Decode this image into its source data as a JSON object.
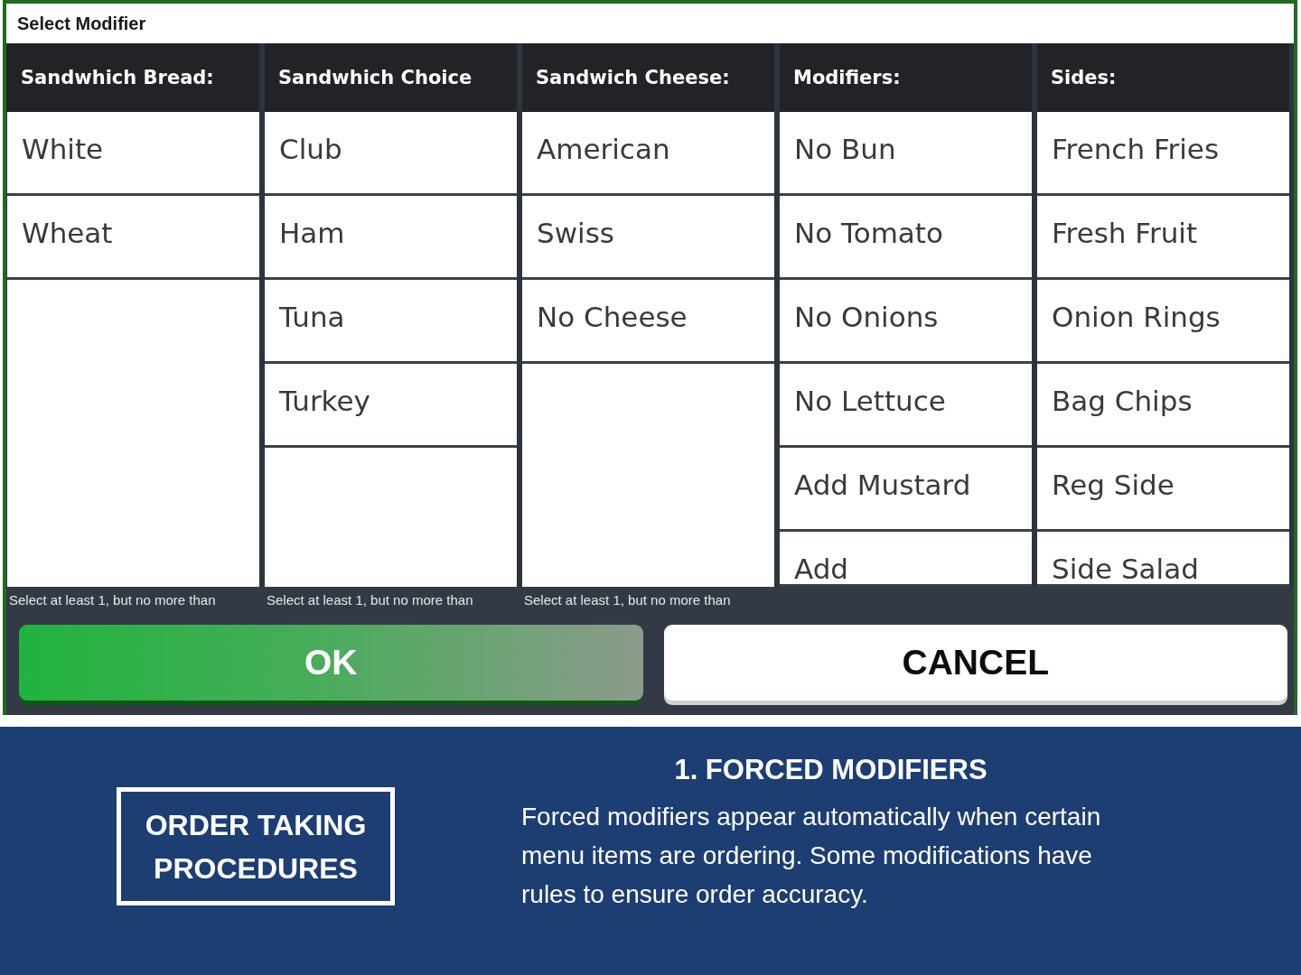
{
  "window": {
    "title": "Select Modifier"
  },
  "columns": [
    {
      "heading": "Sandwhich Bread:",
      "items": [
        "White",
        "Wheat"
      ],
      "note": "Select at least 1, but no more than"
    },
    {
      "heading": "Sandwhich Choice",
      "items": [
        "Club",
        "Ham",
        "Tuna",
        "Turkey"
      ],
      "note": "Select at least 1, but no more than"
    },
    {
      "heading": "Sandwich Cheese:",
      "items": [
        "American",
        "Swiss",
        "No Cheese"
      ],
      "note": "Select at least 1, but no more than"
    },
    {
      "heading": "Modifiers:",
      "items": [
        "No Bun",
        "No Tomato",
        "No Onions",
        "No Lettuce",
        "Add Mustard",
        "Add"
      ]
    },
    {
      "heading": "Sides:",
      "items": [
        "French Fries",
        "Fresh Fruit",
        "Onion Rings",
        "Bag Chips",
        "Reg Side",
        "Side Salad"
      ]
    }
  ],
  "buttons": [
    {
      "label": "OK",
      "kind": "confirm"
    },
    {
      "label": "CANCEL",
      "kind": "cancel"
    }
  ],
  "slide": {
    "badge": "ORDER TAKING PROCEDURES",
    "heading": "1. FORCED MODIFIERS",
    "body": "Forced modifiers appear automatically when certain menu items are ordering. Some modifications have rules to ensure order accuracy."
  }
}
